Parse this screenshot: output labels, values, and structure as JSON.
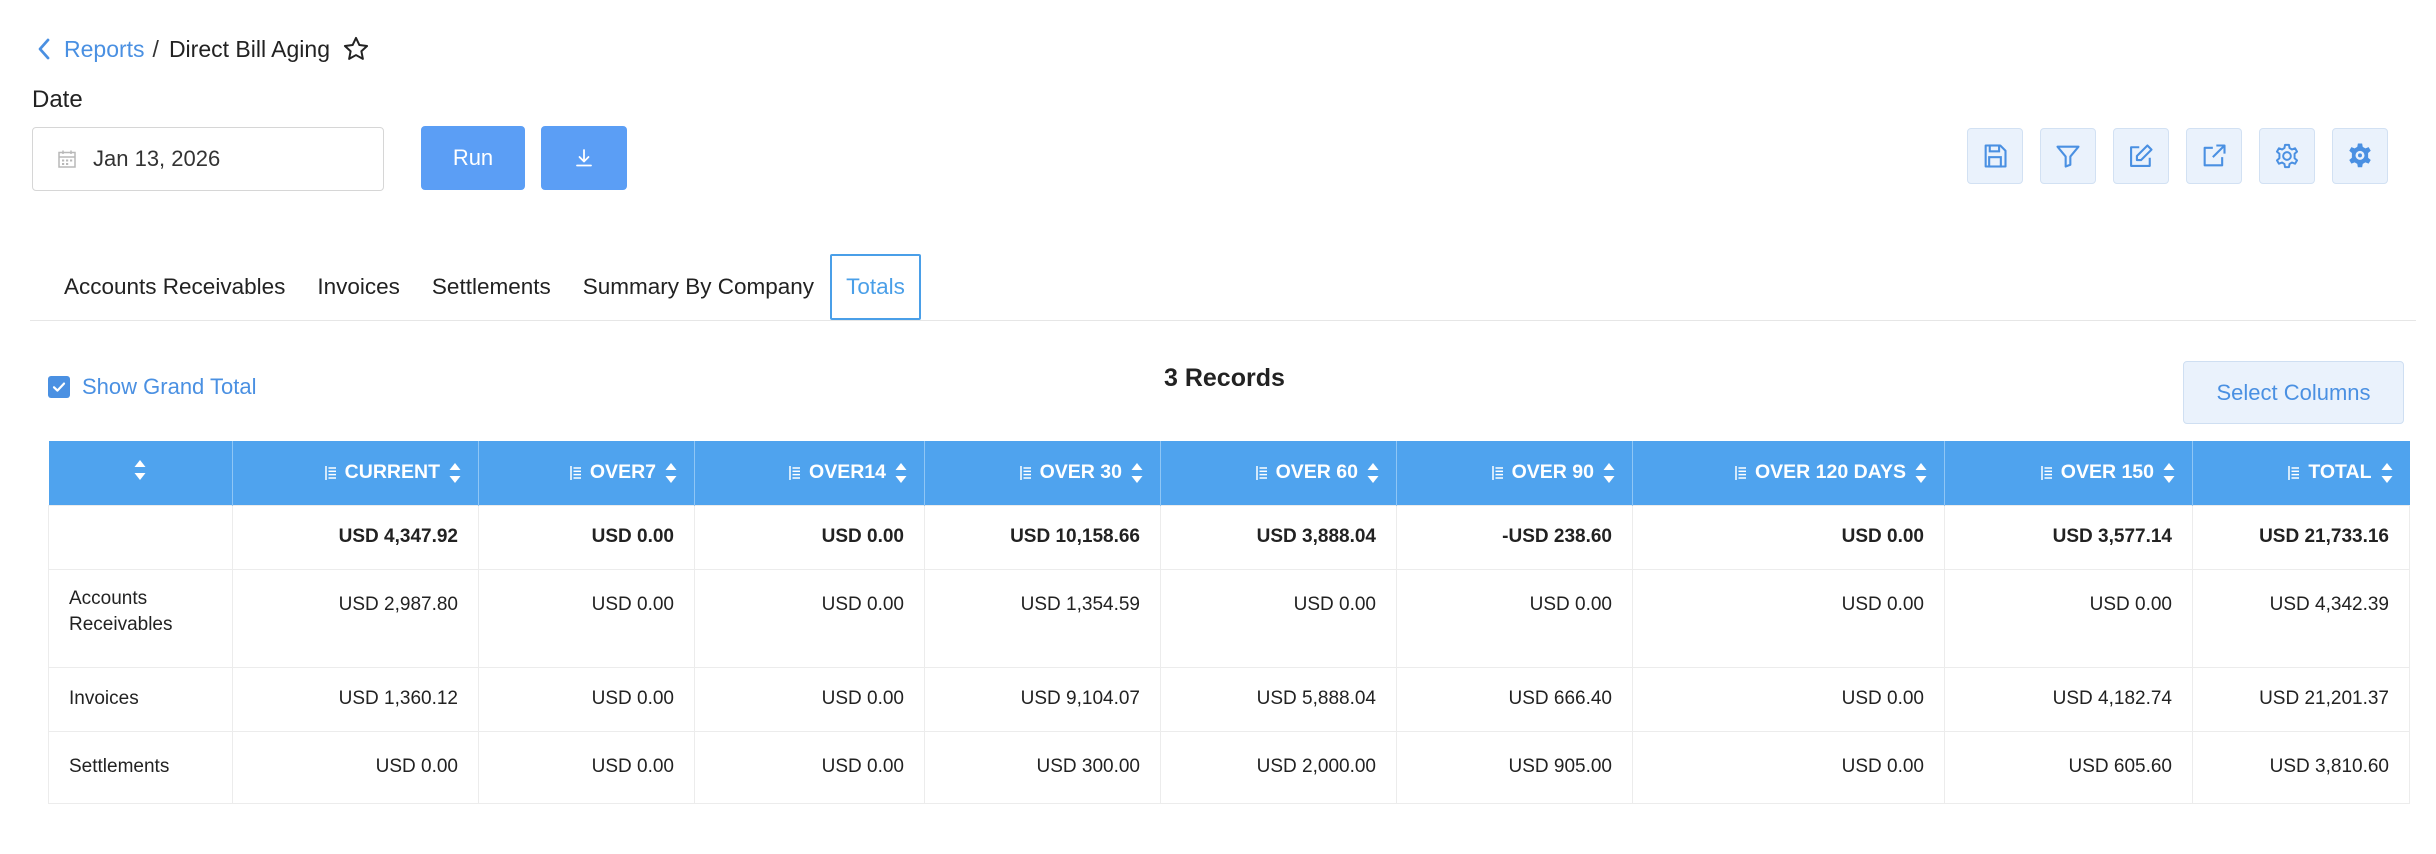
{
  "breadcrumb": {
    "parent": "Reports",
    "separator": "/",
    "current": "Direct Bill Aging"
  },
  "filters": {
    "date_label": "Date",
    "date_value": "Jan 13, 2026"
  },
  "actions": {
    "run_label": "Run"
  },
  "toolbar": [
    "save-icon",
    "filter-icon",
    "edit-icon",
    "external-link-icon",
    "gear-icon",
    "gear-badge-icon"
  ],
  "tabs": [
    "Accounts Receivables",
    "Invoices",
    "Settlements",
    "Summary By Company",
    "Totals"
  ],
  "active_tab": "Totals",
  "grand_total": {
    "label": "Show Grand Total",
    "checked": true
  },
  "records_label": "3 Records",
  "select_columns_label": "Select Columns",
  "table": {
    "columns": [
      "",
      "CURRENT",
      "OVER7",
      "OVER14",
      "OVER 30",
      "OVER 60",
      "OVER 90",
      "OVER 120 DAYS",
      "OVER 150",
      "TOTAL"
    ],
    "total_row": [
      "",
      "USD 4,347.92",
      "USD 0.00",
      "USD 0.00",
      "USD 10,158.66",
      "USD 3,888.04",
      "-USD 238.60",
      "USD 0.00",
      "USD 3,577.14",
      "USD 21,733.16"
    ],
    "rows": [
      [
        "Accounts Receivables",
        "USD 2,987.80",
        "USD 0.00",
        "USD 0.00",
        "USD 1,354.59",
        "USD 0.00",
        "USD 0.00",
        "USD 0.00",
        "USD 0.00",
        "USD 4,342.39"
      ],
      [
        "Invoices",
        "USD 1,360.12",
        "USD 0.00",
        "USD 0.00",
        "USD 9,104.07",
        "USD 5,888.04",
        "USD 666.40",
        "USD 0.00",
        "USD 4,182.74",
        "USD 21,201.37"
      ],
      [
        "Settlements",
        "USD 0.00",
        "USD 0.00",
        "USD 0.00",
        "USD 300.00",
        "USD 2,000.00",
        "USD 905.00",
        "USD 0.00",
        "USD 605.60",
        "USD 3,810.60"
      ]
    ]
  },
  "colors": {
    "accent": "#4a90e2",
    "header_bg": "#4fa3ee",
    "button_bg": "#5b9ef5"
  }
}
